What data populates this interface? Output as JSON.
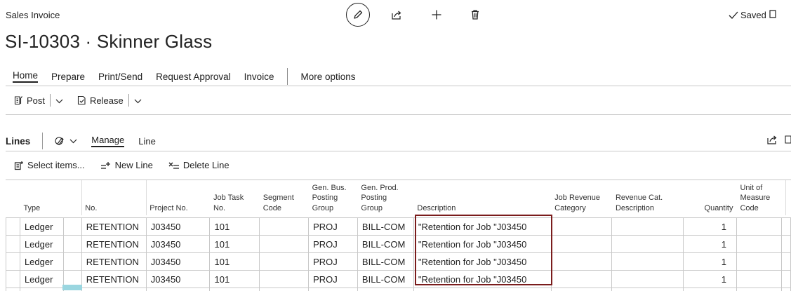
{
  "page": {
    "breadcrumb": "Sales Invoice",
    "title": "SI-10303 · Skinner Glass",
    "saved_label": "Saved"
  },
  "header_icons": [
    "pencil-icon",
    "share-icon",
    "plus-icon",
    "trash-icon"
  ],
  "action_tabs": [
    "Home",
    "Prepare",
    "Print/Send",
    "Request Approval",
    "Invoice"
  ],
  "more_options": "More options",
  "home_actions": {
    "post": "Post",
    "release": "Release"
  },
  "lines": {
    "label": "Lines",
    "tabs": [
      "Manage",
      "Line"
    ],
    "actions": {
      "select_items": "Select items...",
      "new_line": "New Line",
      "delete_line": "Delete Line"
    }
  },
  "table": {
    "columns": [
      [
        "Type"
      ],
      [
        "No."
      ],
      [
        "Project No."
      ],
      [
        "Job Task",
        "No."
      ],
      [
        "Segment",
        "Code"
      ],
      [
        "Gen. Bus.",
        "Posting",
        "Group"
      ],
      [
        "Gen. Prod.",
        "Posting",
        "Group"
      ],
      [
        "Description"
      ],
      [
        "Job Revenue",
        "Category"
      ],
      [
        "Revenue Cat.",
        "Description"
      ],
      [
        "Quantity"
      ],
      [
        "Unit of",
        "Measure",
        "Code"
      ]
    ],
    "rows": [
      {
        "type": "Ledger",
        "no": "RETENTION",
        "project_no": "J03450",
        "job_task_no": "101",
        "segment_code": "",
        "gen_bus": "PROJ",
        "gen_prod": "BILL-COM",
        "description": "\"Retention for Job \"J03450",
        "job_rev_cat": "",
        "rev_cat_desc": "",
        "quantity": "1",
        "uom": ""
      },
      {
        "type": "Ledger",
        "no": "RETENTION",
        "project_no": "J03450",
        "job_task_no": "101",
        "segment_code": "",
        "gen_bus": "PROJ",
        "gen_prod": "BILL-COM",
        "description": "\"Retention for Job \"J03450",
        "job_rev_cat": "",
        "rev_cat_desc": "",
        "quantity": "1",
        "uom": ""
      },
      {
        "type": "Ledger",
        "no": "RETENTION",
        "project_no": "J03450",
        "job_task_no": "101",
        "segment_code": "",
        "gen_bus": "PROJ",
        "gen_prod": "BILL-COM",
        "description": "\"Retention for Job \"J03450",
        "job_rev_cat": "",
        "rev_cat_desc": "",
        "quantity": "1",
        "uom": ""
      },
      {
        "type": "Ledger",
        "no": "RETENTION",
        "project_no": "J03450",
        "job_task_no": "101",
        "segment_code": "",
        "gen_bus": "PROJ",
        "gen_prod": "BILL-COM",
        "description": "\"Retention for Job \"J03450",
        "job_rev_cat": "",
        "rev_cat_desc": "",
        "quantity": "1",
        "uom": ""
      }
    ]
  },
  "colors": {
    "highlight_border": "#7a1c1c",
    "selected_cell": "#9ad6e0"
  }
}
